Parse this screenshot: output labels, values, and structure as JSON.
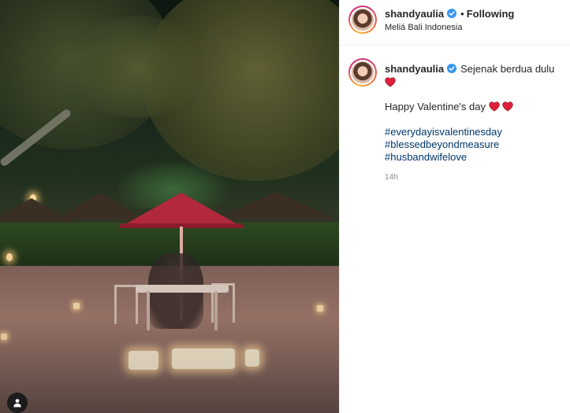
{
  "post": {
    "username": "shandyaulia",
    "follow_status": "Following",
    "location": "Meliá Bali Indonesia"
  },
  "caption": {
    "username": "shandyaulia",
    "line1": "Sejenak berdua dulu",
    "line2": "Happy Valentine's day",
    "hashtags": [
      "#everydayisvalentinesday",
      "#blessedbeyondmeasure",
      "#husbandwifelove"
    ],
    "timestamp": "14h"
  },
  "icons": {
    "verified": "verified-badge-icon",
    "heart": "red-heart-icon",
    "tag": "user-tag-icon"
  },
  "colors": {
    "verified_blue": "#3897f0",
    "heart_red": "#e0203a",
    "hashtag_blue": "#00376b",
    "umbrella_red": "#b3283c"
  }
}
